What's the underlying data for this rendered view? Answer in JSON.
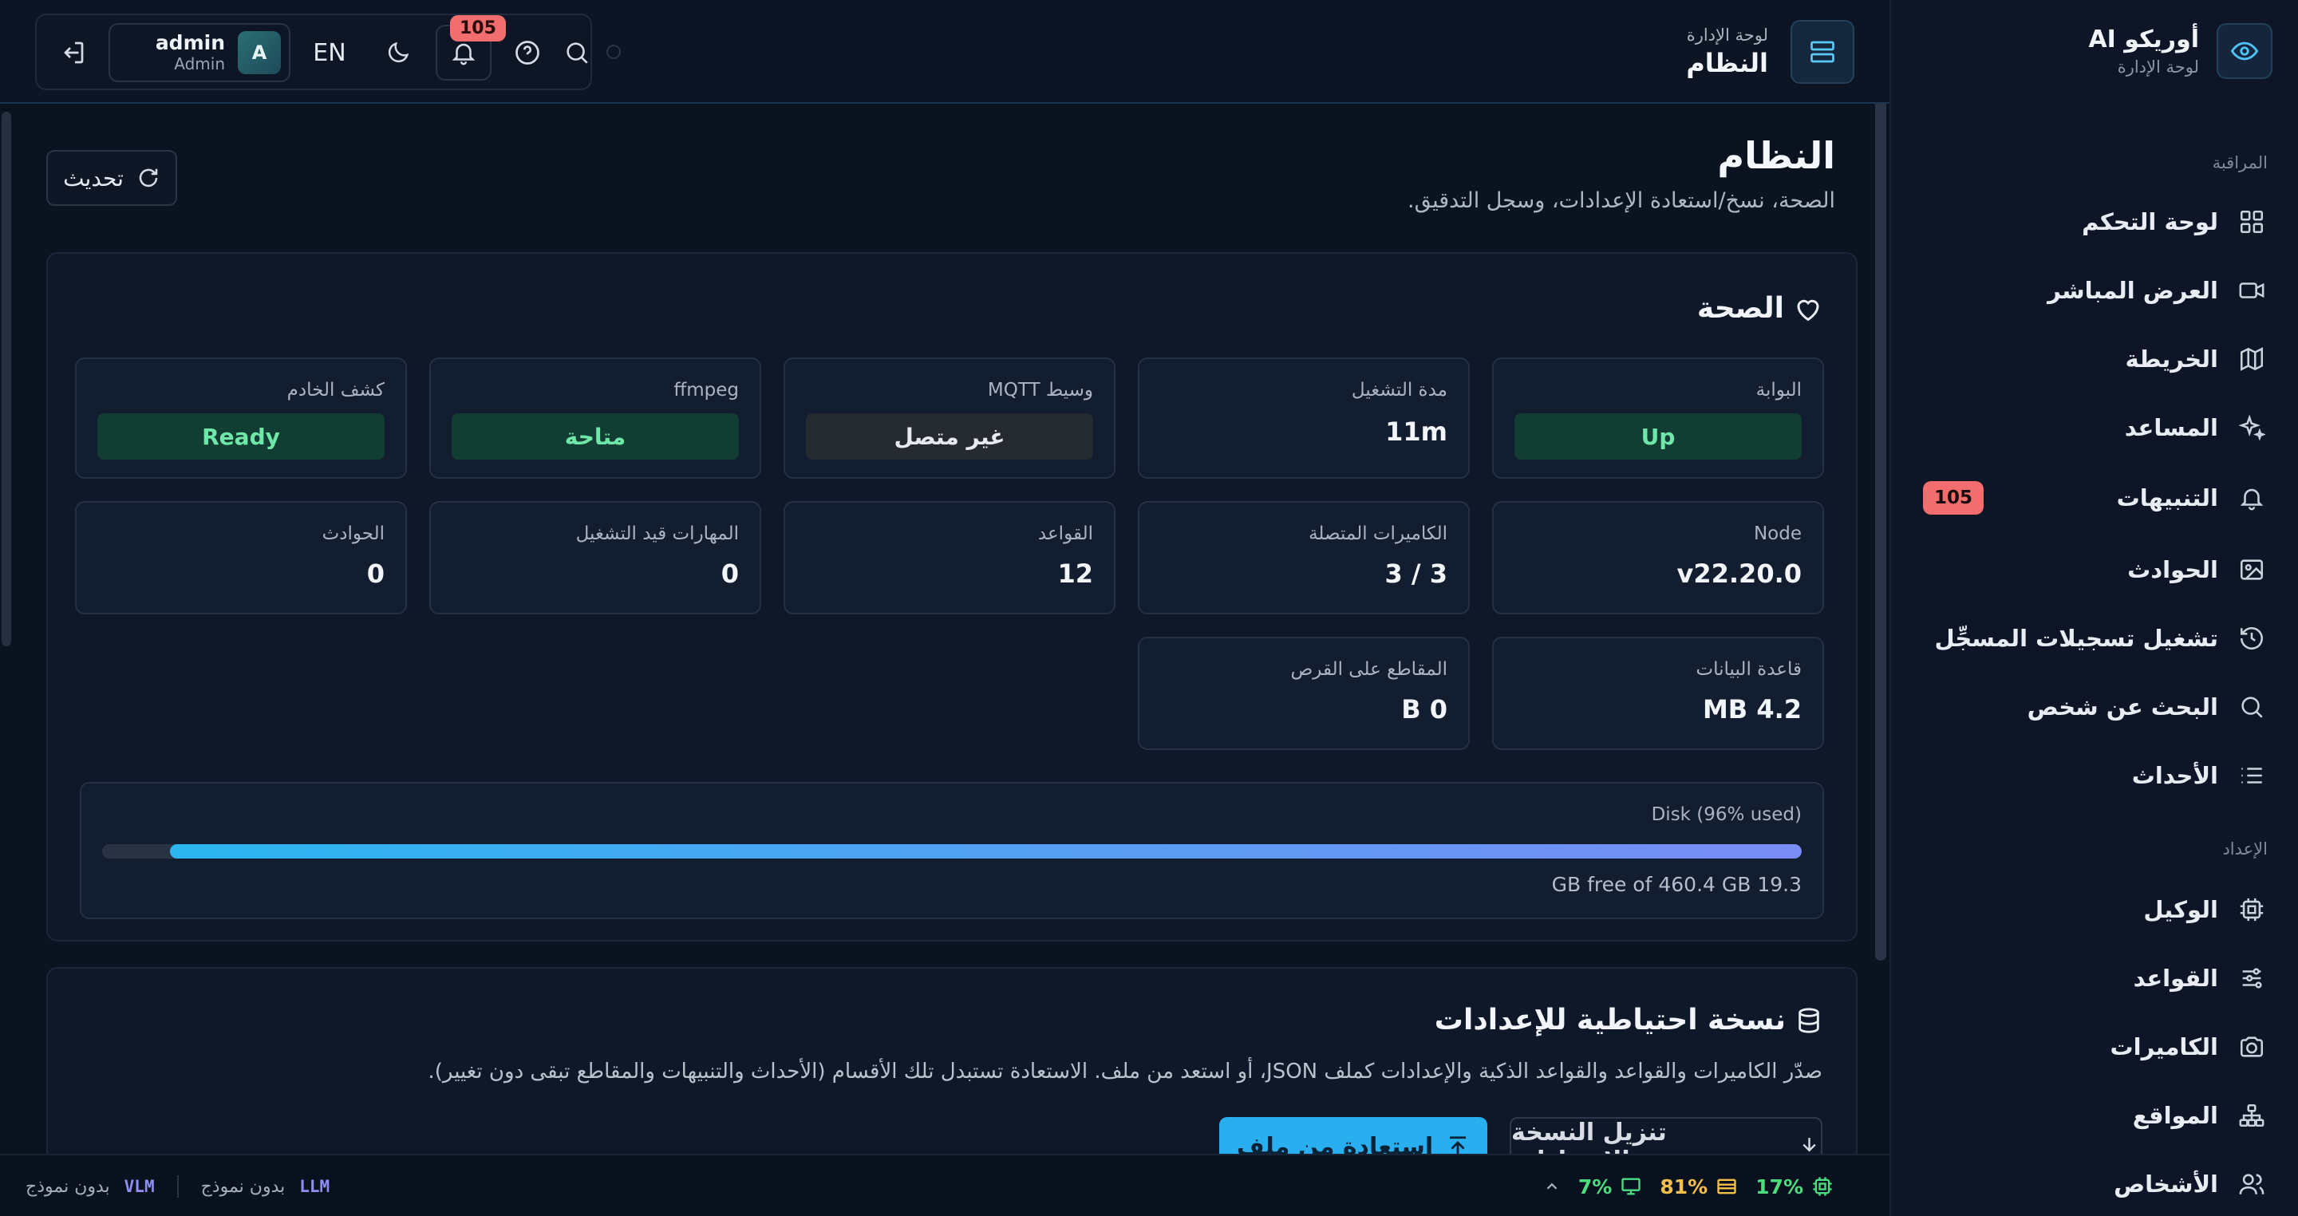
{
  "brand": {
    "name": "أوريكو AI",
    "subtitle": "لوحة الإدارة"
  },
  "sidebar": {
    "section_monitoring": "المراقبة",
    "section_setup": "الإعداد",
    "items": [
      {
        "label": "لوحة التحكم",
        "icon": "grid-icon"
      },
      {
        "label": "العرض المباشر",
        "icon": "video-icon"
      },
      {
        "label": "الخريطة",
        "icon": "map-icon"
      },
      {
        "label": "المساعد",
        "icon": "sparkles-icon"
      },
      {
        "label": "التنبيهات",
        "icon": "bell-icon",
        "badge": "105"
      },
      {
        "label": "الحوادث",
        "icon": "image-icon"
      },
      {
        "label": "تشغيل تسجيلات المسجِّل",
        "icon": "history-icon"
      },
      {
        "label": "البحث عن شخص",
        "icon": "search-icon"
      },
      {
        "label": "الأحداث",
        "icon": "list-icon"
      },
      {
        "label": "الوكيل",
        "icon": "cpu-icon"
      },
      {
        "label": "القواعد",
        "icon": "sliders-icon"
      },
      {
        "label": "الكاميرات",
        "icon": "camera-icon"
      },
      {
        "label": "المواقع",
        "icon": "network-icon"
      },
      {
        "label": "الأشخاص",
        "icon": "users-icon"
      }
    ]
  },
  "topbar": {
    "crumb_sub": "لوحة الإدارة",
    "crumb_title": "النظام",
    "notif_count": "105",
    "lang": "EN",
    "user_name": "admin",
    "user_role": "Admin",
    "avatar_letter": "A"
  },
  "page": {
    "title": "النظام",
    "subtitle": "الصحة، نسخ/استعادة الإعدادات، وسجل التدقيق.",
    "refresh_label": "تحديث"
  },
  "health": {
    "title": "الصحة",
    "tiles": {
      "gateway": {
        "label": "البوابة",
        "value": "Up"
      },
      "uptime": {
        "label": "مدة التشغيل",
        "value": "11m"
      },
      "mqtt": {
        "label": "وسيط MQTT",
        "value": "غير متصل"
      },
      "ffmpeg": {
        "label": "ffmpeg",
        "value": "متاحة"
      },
      "discovery": {
        "label": "كشف الخادم",
        "value": "Ready"
      },
      "node": {
        "label": "Node",
        "value": "v22.20.0"
      },
      "cameras": {
        "label": "الكاميرات المتصلة",
        "value": "3 / 3"
      },
      "rules": {
        "label": "القواعد",
        "value": "12"
      },
      "skills": {
        "label": "المهارات قيد التشغيل",
        "value": "0"
      },
      "incidents": {
        "label": "الحوادث",
        "value": "0"
      },
      "database": {
        "label": "قاعدة البيانات",
        "value": "MB 4.2"
      },
      "clips": {
        "label": "المقاطع على القرص",
        "value": "B 0"
      }
    },
    "disk": {
      "label": "Disk (96% used)",
      "used_percent": 96,
      "free_text": "GB free of 460.4 GB 19.3"
    }
  },
  "backup": {
    "title": "نسخة احتياطية للإعدادات",
    "description": "صدّر الكاميرات والقواعد والقواعد الذكية والإعدادات كملف JSON، أو استعد من ملف. الاستعادة تستبدل تلك الأقسام (الأحداث والتنبيهات والمقاطع تبقى دون تغيير).",
    "download_label": "تنزيل النسخة الاحتياطية",
    "restore_label": "استعادة من ملف"
  },
  "statusbar": {
    "llm_tag": "LLM",
    "llm_value": "بدون نموذج",
    "vlm_tag": "VLM",
    "vlm_value": "بدون نموذج",
    "cpu": "17%",
    "mem": "81%",
    "gpu": "7%"
  },
  "colors": {
    "accent": "#29aef0",
    "ok": "#6ee7a8",
    "danger": "#f26d6d",
    "warn": "#f5c04a"
  }
}
